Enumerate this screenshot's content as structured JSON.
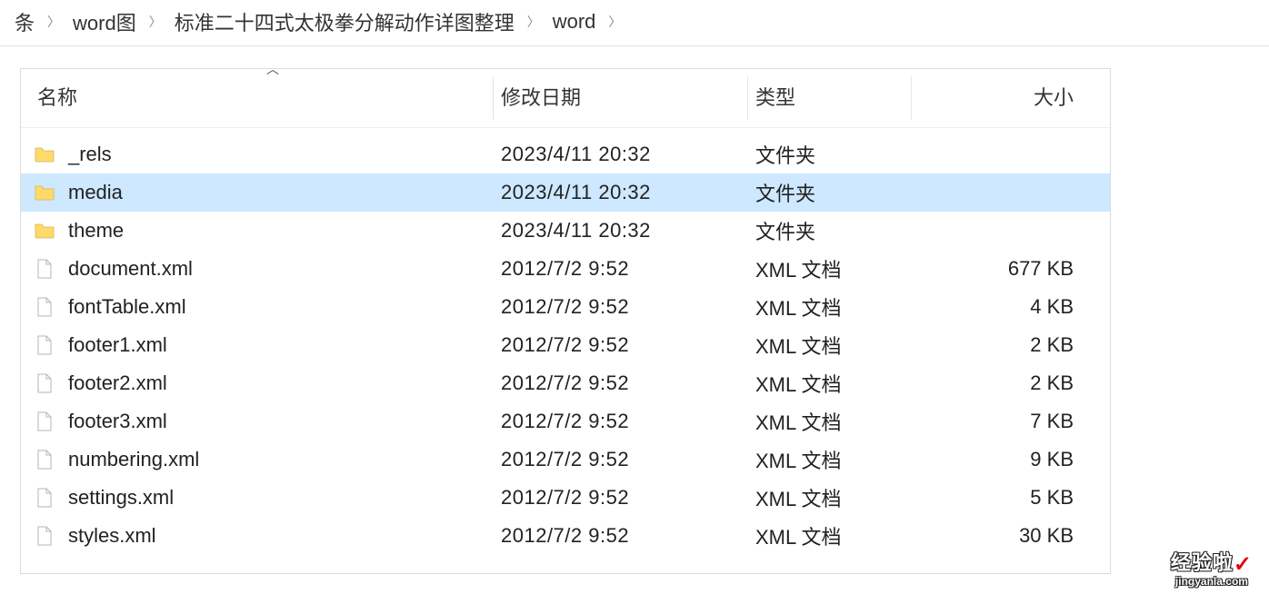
{
  "breadcrumb": [
    {
      "label": "条"
    },
    {
      "label": "word图"
    },
    {
      "label": "标准二十四式太极拳分解动作详图整理"
    },
    {
      "label": "word"
    }
  ],
  "columns": {
    "name": "名称",
    "date": "修改日期",
    "type": "类型",
    "size": "大小"
  },
  "rows": [
    {
      "icon": "folder",
      "name": "_rels",
      "date": "2023/4/11 20:32",
      "type": "文件夹",
      "size": "",
      "selected": false
    },
    {
      "icon": "folder",
      "name": "media",
      "date": "2023/4/11 20:32",
      "type": "文件夹",
      "size": "",
      "selected": true
    },
    {
      "icon": "folder",
      "name": "theme",
      "date": "2023/4/11 20:32",
      "type": "文件夹",
      "size": "",
      "selected": false
    },
    {
      "icon": "file",
      "name": "document.xml",
      "date": "2012/7/2 9:52",
      "type": "XML 文档",
      "size": "677 KB",
      "selected": false
    },
    {
      "icon": "file",
      "name": "fontTable.xml",
      "date": "2012/7/2 9:52",
      "type": "XML 文档",
      "size": "4 KB",
      "selected": false
    },
    {
      "icon": "file",
      "name": "footer1.xml",
      "date": "2012/7/2 9:52",
      "type": "XML 文档",
      "size": "2 KB",
      "selected": false
    },
    {
      "icon": "file",
      "name": "footer2.xml",
      "date": "2012/7/2 9:52",
      "type": "XML 文档",
      "size": "2 KB",
      "selected": false
    },
    {
      "icon": "file",
      "name": "footer3.xml",
      "date": "2012/7/2 9:52",
      "type": "XML 文档",
      "size": "7 KB",
      "selected": false
    },
    {
      "icon": "file",
      "name": "numbering.xml",
      "date": "2012/7/2 9:52",
      "type": "XML 文档",
      "size": "9 KB",
      "selected": false
    },
    {
      "icon": "file",
      "name": "settings.xml",
      "date": "2012/7/2 9:52",
      "type": "XML 文档",
      "size": "5 KB",
      "selected": false
    },
    {
      "icon": "file",
      "name": "styles.xml",
      "date": "2012/7/2 9:52",
      "type": "XML 文档",
      "size": "30 KB",
      "selected": false
    }
  ],
  "watermark": {
    "title": "经验啦",
    "url": "jingyanla.com"
  }
}
